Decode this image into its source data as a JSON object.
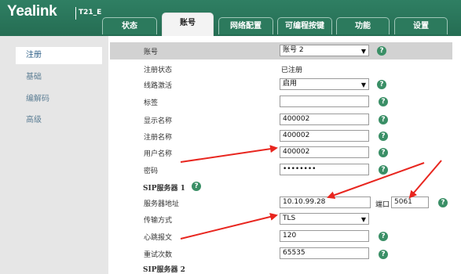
{
  "header": {
    "logo": "Yealink",
    "model": "T21_E2",
    "tabs": [
      {
        "label": "状态"
      },
      {
        "label": "账号"
      },
      {
        "label": "网络配置"
      },
      {
        "label": "可编程按键"
      },
      {
        "label": "功能"
      },
      {
        "label": "设置"
      }
    ]
  },
  "sidebar": {
    "items": [
      {
        "label": "注册"
      },
      {
        "label": "基础"
      },
      {
        "label": "编解码"
      },
      {
        "label": "高级"
      }
    ]
  },
  "form": {
    "account": {
      "label": "账号",
      "value": "账号 2"
    },
    "reg_status": {
      "label": "注册状态",
      "value": "已注册"
    },
    "line_active": {
      "label": "线路激活",
      "value": "启用"
    },
    "tag": {
      "label": "标签",
      "value": ""
    },
    "display_name": {
      "label": "显示名称",
      "value": "400002"
    },
    "register_name": {
      "label": "注册名称",
      "value": "400002"
    },
    "user_name": {
      "label": "用户名称",
      "value": "400002"
    },
    "password": {
      "label": "密码",
      "value": "••••••••"
    },
    "sip_server_1": {
      "label": "SIP服务器 1"
    },
    "server_address": {
      "label": "服务器地址",
      "value": "10.10.99.28",
      "port_label": "端口",
      "port_value": "5061"
    },
    "transport": {
      "label": "传输方式",
      "value": "TLS"
    },
    "heartbeat": {
      "label": "心跳报文",
      "value": "120"
    },
    "retry": {
      "label": "重试次数",
      "value": "65535"
    },
    "sip_server_2": {
      "label": "SIP服务器 2"
    }
  },
  "help_glyph": "?",
  "colors": {
    "header": "#2f7f63",
    "help": "#3a8f66",
    "arrow": "#e8261f",
    "sidebar_text": "#5d7f95"
  }
}
